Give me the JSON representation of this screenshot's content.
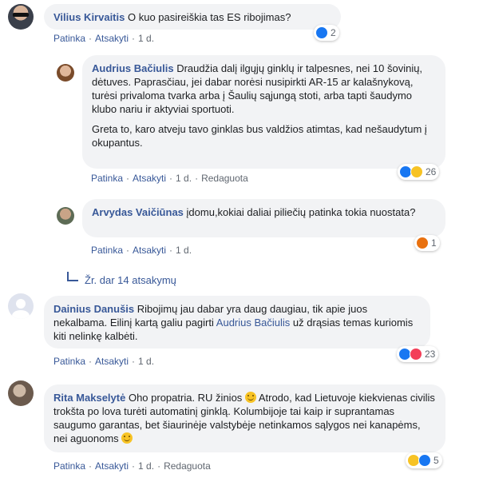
{
  "comments": [
    {
      "author": "Vilius Kirvaitis",
      "text": "O kuo pasireiškia tas ES ribojimas?",
      "actions": [
        "Patinka",
        "Atsakyti",
        "1 d."
      ],
      "reaction_count": "2"
    },
    {
      "author": "Audrius Bačiulis",
      "text_p1": "Draudžia dalį ilgųjų ginklų ir talpesnes, nei 10 šovinių, dėtuves. Paprasčiau, jei dabar norėsi nusipirkti AR-15 ar kalašnykovą, turėsi privaloma tvarka arba į Šaulių sąjungą stoti, arba tapti šaudymo klubo nariu ir aktyviai sportuoti.",
      "text_p2": "Greta to, karo atveju tavo ginklas bus valdžios atimtas, kad nešaudytum į okupantus.",
      "actions": [
        "Patinka",
        "Atsakyti",
        "1 d.",
        "Redaguota"
      ],
      "reaction_count": "26"
    },
    {
      "author": "Arvydas Vaičiūnas",
      "text": "įdomu,kokiai daliai piliečių patinka tokia nuostata?",
      "actions": [
        "Patinka",
        "Atsakyti",
        "1 d."
      ],
      "reaction_count": "1"
    },
    {
      "author": "Dainius Danušis",
      "text_a": "Ribojimų jau dabar yra daug daugiau, tik apie juos nekalbama. Eilinį kartą galiu pagirti",
      "mention": "Audrius Bačiulis",
      "text_b": "už drąsias temas kuriomis kiti nelinkę kalbėti.",
      "actions": [
        "Patinka",
        "Atsakyti",
        "1 d."
      ],
      "reaction_count": "23"
    },
    {
      "author": "Rita Makselytė",
      "text_a": "Oho propatria. RU žinios",
      "text_b": "Atrodo, kad Lietuvoje kiekvienas civilis trokšta po lova turėti automatinį ginklą. Kolumbijoje tai kaip ir suprantamas saugumo garantas, bet šiaurinėje valstybėje netinkamos sąlygos nei kanapėms, nei aguonoms",
      "actions": [
        "Patinka",
        "Atsakyti",
        "1 d.",
        "Redaguota"
      ],
      "reaction_count": "5"
    }
  ],
  "more_replies": "Žr. dar 14 atsakymų",
  "icons": {
    "more": "reply-arrow-icon",
    "like": "like-icon",
    "love": "love-icon",
    "sad": "sad-icon",
    "angry": "angry-icon",
    "haha": "haha-icon",
    "smile": "smile-emoji-icon"
  },
  "colors": {
    "link": "#385898",
    "bubble": "#f2f3f5",
    "like": "#1877f2",
    "love": "#f33e58",
    "emoji": "#f7c325",
    "angry": "#e9710f"
  }
}
